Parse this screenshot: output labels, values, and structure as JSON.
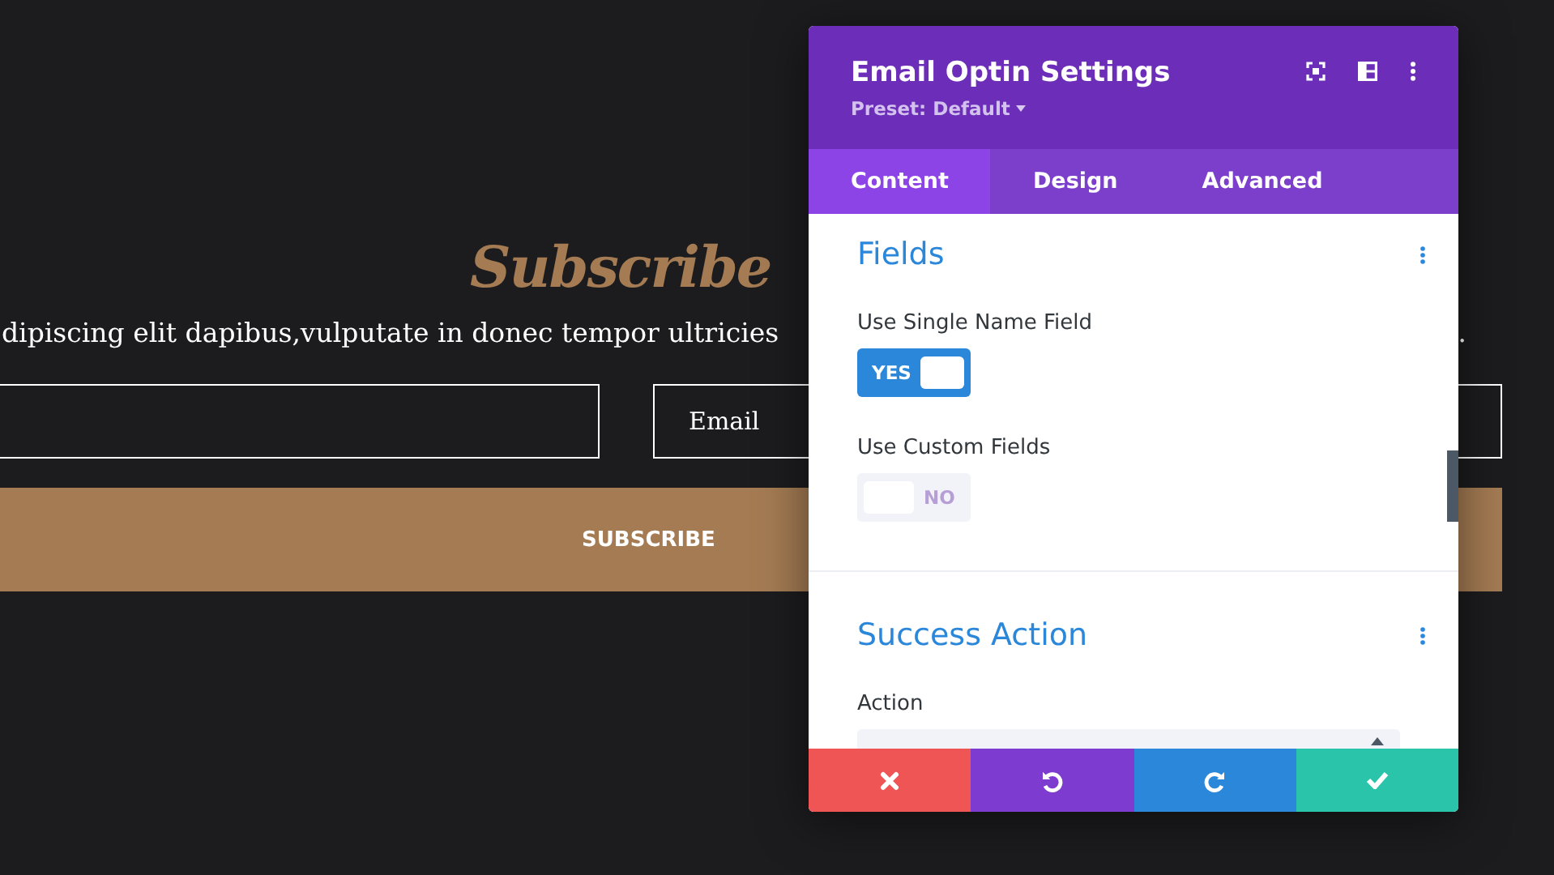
{
  "page": {
    "title": "Subscribe",
    "description": "dipiscing elit dapibus,vulputate in donec tempor ultricies",
    "description_end": ".",
    "fields": [
      {
        "kind": "name"
      },
      {
        "kind": "email",
        "placeholder": "Email"
      }
    ],
    "button": "SUBSCRIBE"
  },
  "modal": {
    "title": "Email Optin Settings",
    "preset": "Preset: Default",
    "tabs": [
      {
        "label": "Content",
        "selected": true
      },
      {
        "label": "Design",
        "selected": false
      },
      {
        "label": "Advanced",
        "selected": false
      }
    ],
    "sections": [
      {
        "title": "Fields",
        "options": [
          {
            "kind": "toggle",
            "label": "Use Single Name Field",
            "on": true,
            "text": "YES"
          },
          {
            "kind": "toggle",
            "label": "Use Custom Fields",
            "on": false,
            "text": "NO"
          }
        ]
      },
      {
        "title": "Success Action",
        "options": [
          {
            "kind": "select",
            "label": "Action"
          }
        ]
      }
    ],
    "footer": [
      {
        "kind": "cancel"
      },
      {
        "kind": "undo"
      },
      {
        "kind": "redo"
      },
      {
        "kind": "save"
      }
    ]
  }
}
